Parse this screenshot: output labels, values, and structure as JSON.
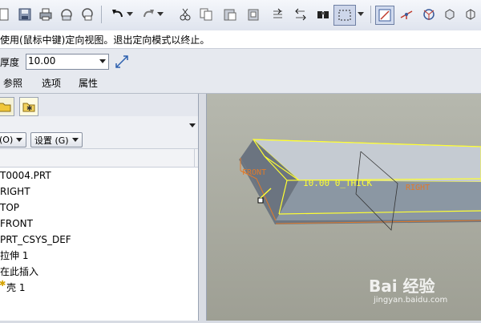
{
  "message": "使用(鼠标中键)定向视图。退出定向模式以终止。",
  "dashboard": {
    "thickness_label": "厚度",
    "thickness_value": "10.00",
    "tabs": [
      "参照",
      "选项",
      "属性"
    ]
  },
  "left_panel": {
    "show_button": "(O)",
    "settings_button": "设置 (G)",
    "tree": [
      "T0004.PRT",
      "RIGHT",
      "TOP",
      "FRONT",
      "PRT_CSYS_DEF",
      "拉伸 1",
      "在此插入",
      "壳 1"
    ]
  },
  "viewport": {
    "label_front": "FRONT",
    "dimension": "10.00 0_THICK",
    "label_right": "RIGHT"
  },
  "watermark": {
    "brand": "Bai 经验",
    "url": "jingyan.baidu.com"
  },
  "colors": {
    "highlight": "#ffff33",
    "datum": "#e07a2a",
    "model": "#8b97a3"
  },
  "icons": [
    "undo-icon",
    "redo-icon",
    "cut-icon",
    "copy-icon",
    "paste-icon",
    "regenerate-icon",
    "find-icon",
    "select-box-icon",
    "plane-display-icon",
    "axis-display-icon",
    "csys-display-icon",
    "view-icon"
  ]
}
